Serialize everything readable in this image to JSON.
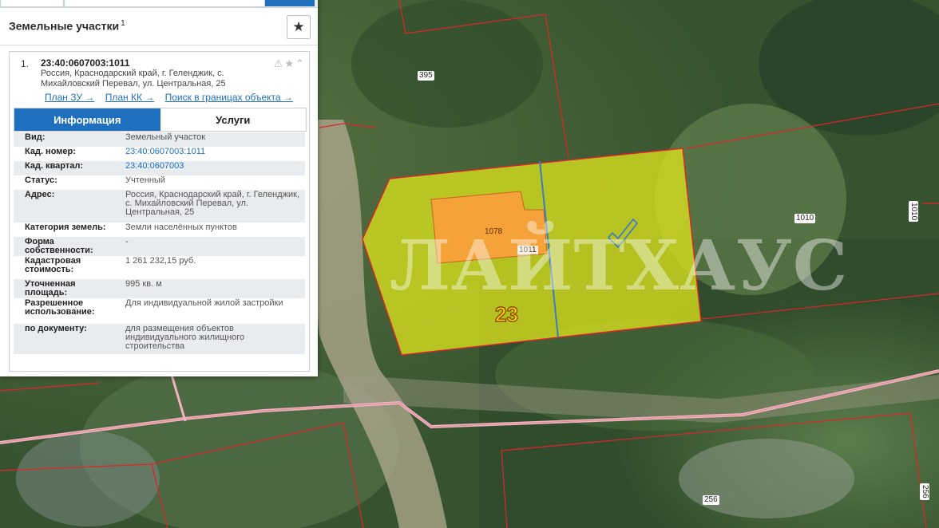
{
  "panel": {
    "title": "Земельные участки",
    "title_count": "1",
    "fav_icon": "star-icon"
  },
  "card": {
    "index": "1.",
    "cadastral_number": "23:40:0607003:1011",
    "address_line1": "Россия, Краснодарский край, г. Геленджик, с.",
    "address_line2": "Михайловский Перевал, ул. Центральная, 25",
    "icons": [
      "warning-icon",
      "star-icon",
      "chevron-up-icon"
    ],
    "links": [
      {
        "label": "План ЗУ →"
      },
      {
        "label": "План КК →"
      },
      {
        "label": "Поиск в границах объекта →"
      }
    ],
    "tabs": [
      {
        "label": "Информация",
        "active": true
      },
      {
        "label": "Услуги",
        "active": false
      }
    ],
    "fields": [
      {
        "key": "Вид:",
        "value": "Земельный участок"
      },
      {
        "key": "Кад. номер:",
        "value": "23:40:0607003:1011"
      },
      {
        "key": "Кад. квартал:",
        "value": "23:40:0607003"
      },
      {
        "key": "Статус:",
        "value": "Учтенный"
      },
      {
        "key": "Адрес:",
        "value": "Россия, Краснодарский край, г. Геленджик, с. Михайловский Перевал, ул. Центральная, 25"
      },
      {
        "key": "Категория земель:",
        "value": "Земли населённых пунктов"
      },
      {
        "key": "Форма собственности:",
        "value": "-"
      },
      {
        "key": "Кадастровая стоимость:",
        "value": "1 261 232,15 руб."
      },
      {
        "key": "Уточненная площадь:",
        "value": "995 кв. м"
      },
      {
        "key": "Разрешенное использование:",
        "value": "Для индивидуальной жилой застройки"
      },
      {
        "key": "по документу:",
        "value": "для размещения объектов индивидуального жилищного строительства"
      }
    ]
  },
  "map": {
    "parcel_labels": [
      "395",
      "1010",
      "1010",
      "256",
      "256",
      "1078",
      "1011"
    ],
    "quarter_label": "23",
    "watermark": "ЛАЙТХАУС",
    "colors": {
      "selected_parcel": "#d9e21e",
      "building": "#f5a23a",
      "parcel_border": "#e0242b",
      "road_border": "#f2b3bf"
    }
  }
}
